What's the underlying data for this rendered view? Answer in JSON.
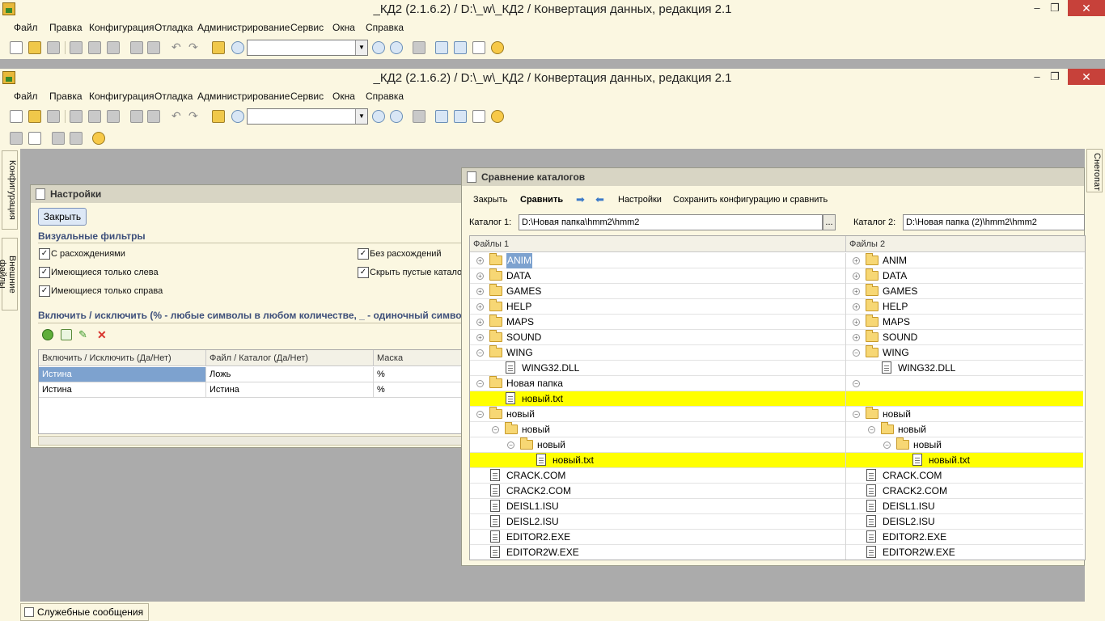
{
  "window": {
    "title": "_КД2 (2.1.6.2) / D:\\_w\\_КД2 / Конвертация данных, редакция 2.1",
    "minimize": "–",
    "restore": "❐",
    "close": "✕"
  },
  "menu": [
    "Файл",
    "Правка",
    "Конфигурация",
    "Отладка",
    "Администрирование",
    "Сервис",
    "Окна",
    "Справка"
  ],
  "left_dock": {
    "tabs": [
      "Конфигурация",
      "Внешние файлы"
    ]
  },
  "right_dock": {
    "tab": "Снегопат"
  },
  "status_bar": {
    "tab": "Служебные сообщения"
  },
  "settings_window": {
    "title": "Настройки",
    "close_button": "Закрыть",
    "visual_filters_title": "Визуальные фильтры",
    "filters": [
      {
        "label": "С расхождениями",
        "checked": true
      },
      {
        "label": "Имеющиеся только слева",
        "checked": true
      },
      {
        "label": "Имеющиеся только справа",
        "checked": true
      },
      {
        "label": "Без расхождений",
        "checked": true
      },
      {
        "label": "Скрыть пустые катало",
        "checked": true
      }
    ],
    "include_title": "Включить / исключить (% - любые символы в любом количестве, _ - одиночный символ",
    "table": {
      "columns": [
        "Включить / Исключить (Да/Нет)",
        "Файл / Каталог (Да/Нет)",
        "Маска"
      ],
      "rows": [
        [
          "Истина",
          "Ложь",
          "%"
        ],
        [
          "Истина",
          "Истина",
          "%"
        ]
      ]
    }
  },
  "compare_window": {
    "title": "Сравнение каталогов",
    "actions": [
      "Закрыть",
      "Сравнить",
      "Настройки",
      "Сохранить конфигурацию и сравнить"
    ],
    "catalog1_label": "Каталог 1:",
    "catalog1_value": "D:\\Новая папка\\hmm2\\hmm2",
    "catalog2_label": "Каталог 2:",
    "catalog2_value": "D:\\Новая папка (2)\\hmm2\\hmm2",
    "browse": "...",
    "columns": [
      "Файлы 1",
      "Файлы 2"
    ],
    "rows": [
      {
        "left": "ANIM",
        "right": "ANIM",
        "type": "folder",
        "state": "collapsed",
        "level": 0,
        "highlight": false
      },
      {
        "left": "DATA",
        "right": "DATA",
        "type": "folder",
        "state": "collapsed",
        "level": 0,
        "highlight": false
      },
      {
        "left": "GAMES",
        "right": "GAMES",
        "type": "folder",
        "state": "collapsed",
        "level": 0,
        "highlight": false
      },
      {
        "left": "HELP",
        "right": "HELP",
        "type": "folder",
        "state": "collapsed",
        "level": 0,
        "highlight": false
      },
      {
        "left": "MAPS",
        "right": "MAPS",
        "type": "folder",
        "state": "collapsed",
        "level": 0,
        "highlight": false
      },
      {
        "left": "SOUND",
        "right": "SOUND",
        "type": "folder",
        "state": "collapsed",
        "level": 0,
        "highlight": false
      },
      {
        "left": "WING",
        "right": "WING",
        "type": "folder",
        "state": "expanded",
        "level": 0,
        "highlight": false
      },
      {
        "left": "WING32.DLL",
        "right": "WING32.DLL",
        "type": "file",
        "level": 1,
        "highlight": false
      },
      {
        "left": "Новая папка",
        "right": "",
        "type": "folder",
        "state": "expanded",
        "level": 0,
        "highlight": false
      },
      {
        "left": "новый.txt",
        "right": "",
        "type": "file",
        "level": 1,
        "highlight": true
      },
      {
        "left": "новый",
        "right": "новый",
        "type": "folder",
        "state": "expanded",
        "level": 0,
        "highlight": false
      },
      {
        "left": "новый",
        "right": "новый",
        "type": "folder",
        "state": "expanded",
        "level": 1,
        "highlight": false
      },
      {
        "left": "новый",
        "right": "новый",
        "type": "folder",
        "state": "expanded",
        "level": 2,
        "highlight": false
      },
      {
        "left": "новый.txt",
        "right": "новый.txt",
        "type": "file",
        "level": 3,
        "highlight": true
      },
      {
        "left": "CRACK.COM",
        "right": "CRACK.COM",
        "type": "file",
        "level": 0,
        "highlight": false
      },
      {
        "left": "CRACK2.COM",
        "right": "CRACK2.COM",
        "type": "file",
        "level": 0,
        "highlight": false
      },
      {
        "left": "DEISL1.ISU",
        "right": "DEISL1.ISU",
        "type": "file",
        "level": 0,
        "highlight": false
      },
      {
        "left": "DEISL2.ISU",
        "right": "DEISL2.ISU",
        "type": "file",
        "level": 0,
        "highlight": false
      },
      {
        "left": "EDITOR2.EXE",
        "right": "EDITOR2.EXE",
        "type": "file",
        "level": 0,
        "highlight": false
      },
      {
        "left": "EDITOR2W.EXE",
        "right": "EDITOR2W.EXE",
        "type": "file",
        "level": 0,
        "highlight": false
      }
    ]
  },
  "colors": {
    "chrome": "#fbf7e1",
    "highlight_row": "#ffff00",
    "selection": "#7da2cf",
    "section_title": "#3d4f7a",
    "close_red": "#c7413a"
  }
}
